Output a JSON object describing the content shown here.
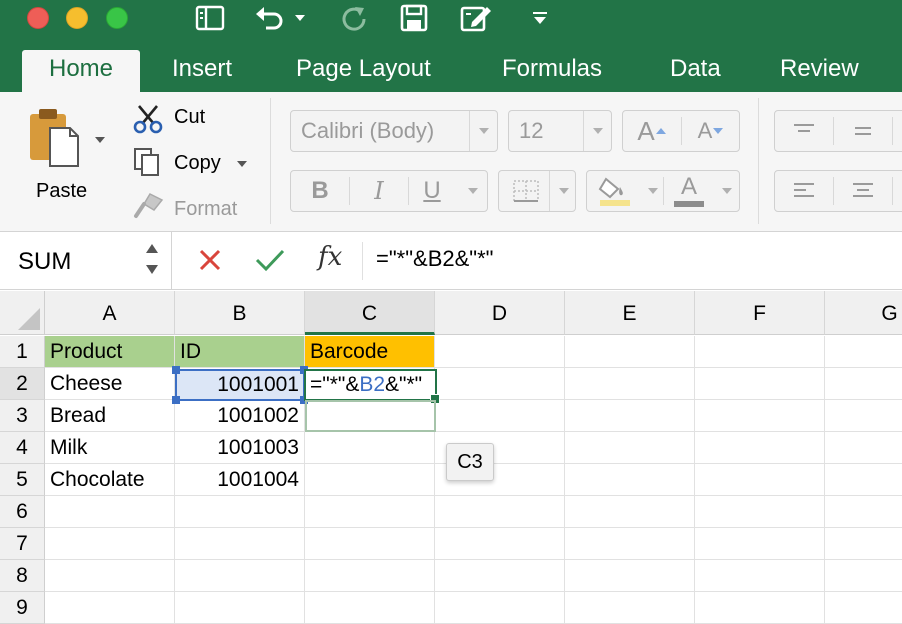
{
  "tabs": [
    "Home",
    "Insert",
    "Page Layout",
    "Formulas",
    "Data",
    "Review"
  ],
  "ribbon": {
    "paste": "Paste",
    "cut": "Cut",
    "copy": "Copy",
    "format": "Format",
    "font_name": "Calibri (Body)",
    "font_size": "12",
    "bold": "B",
    "italic": "I",
    "underline": "U",
    "grow_font": "A",
    "shrink_font": "A",
    "font_color": "A"
  },
  "formula_bar": {
    "name_box": "SUM",
    "fx": "fx",
    "formula": "=\"*\"&B2&\"*\""
  },
  "grid": {
    "columns": [
      "A",
      "B",
      "C",
      "D",
      "E",
      "F",
      "G"
    ],
    "rows": [
      "1",
      "2",
      "3",
      "4",
      "5",
      "6",
      "7",
      "8",
      "9"
    ],
    "cells": {
      "A1": "Product",
      "B1": "ID",
      "C1": "Barcode",
      "A2": "Cheese",
      "B2": "1001001",
      "A3": "Bread",
      "B3": "1001002",
      "A4": "Milk",
      "B4": "1001003",
      "A5": "Chocolate",
      "B5": "1001004"
    },
    "editing": {
      "cell": "C2",
      "prefix": "=\"*\"&",
      "ref": "B2",
      "suffix": "&\"*\""
    },
    "tooltip": "C3"
  },
  "colors": {
    "accent": "#227447",
    "header_green": "#a9d08e",
    "header_orange": "#ffc000",
    "ref_blue": "#3c6fc4",
    "cancel_red": "#d9453c",
    "enter_green": "#3e9a5a"
  }
}
